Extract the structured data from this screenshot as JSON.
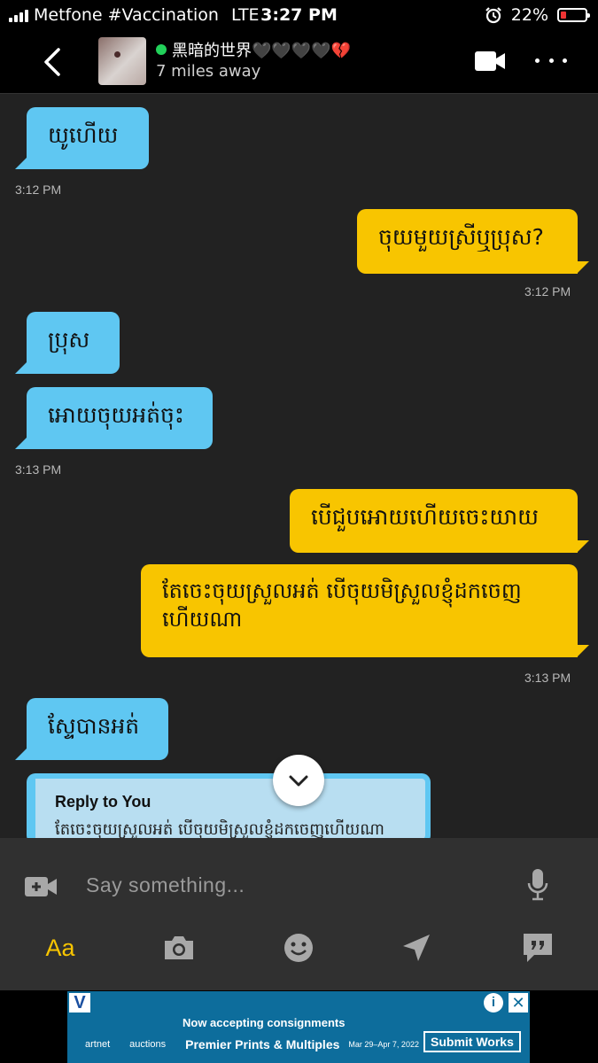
{
  "status_bar": {
    "carrier": "Metfone #Vaccination",
    "network": "LTE",
    "time": "3:27 PM",
    "battery": "22%",
    "battery_level": 0.22,
    "alarm_icon": "alarm-clock-icon"
  },
  "header": {
    "name": "黑暗的世界🖤🖤🖤🖤💔",
    "distance": "7 miles away",
    "online_color": "#22d15a"
  },
  "messages": [
    {
      "dir": "in",
      "text": "យូហើយ"
    },
    {
      "time": "3:12 PM"
    },
    {
      "dir": "out",
      "text": "ចុយមួយស្រីឬប្រុស?"
    },
    {
      "time": "3:12 PM"
    },
    {
      "dir": "in",
      "text": "ប្រុស"
    },
    {
      "dir": "in",
      "text": "អោយចុយអត់ចុះ"
    },
    {
      "time": "3:13 PM"
    },
    {
      "dir": "out",
      "text": "បើជួបអោយហើយចេះយាយ"
    },
    {
      "dir": "out",
      "text": "តែចេះចុយស្រួលអត់ បើចុយមិស្រួលខ្ញុំដកចេញហើយណា"
    },
    {
      "time": "3:13 PM"
    },
    {
      "dir": "in",
      "text": "ស្ទែបានអត់"
    }
  ],
  "reply_preview": {
    "title": "Reply to You",
    "text": "តែចេះចុយស្រួលអត់ បើចុយមិស្រួលខ្ញុំដកចេញហើយណា"
  },
  "input": {
    "placeholder": "Say something...",
    "aa_label": "Aa"
  },
  "ad": {
    "line1": "Now accepting consignments",
    "brand1": "artnet",
    "brand2": "auctions",
    "headline": "Premier Prints & Multiples",
    "dates": "Mar 29–Apr 7, 2022",
    "cta": "Submit Works",
    "logo": "V"
  },
  "colors": {
    "incoming": "#5fc7f2",
    "outgoing": "#f8c500",
    "accent": "#f8c500"
  }
}
